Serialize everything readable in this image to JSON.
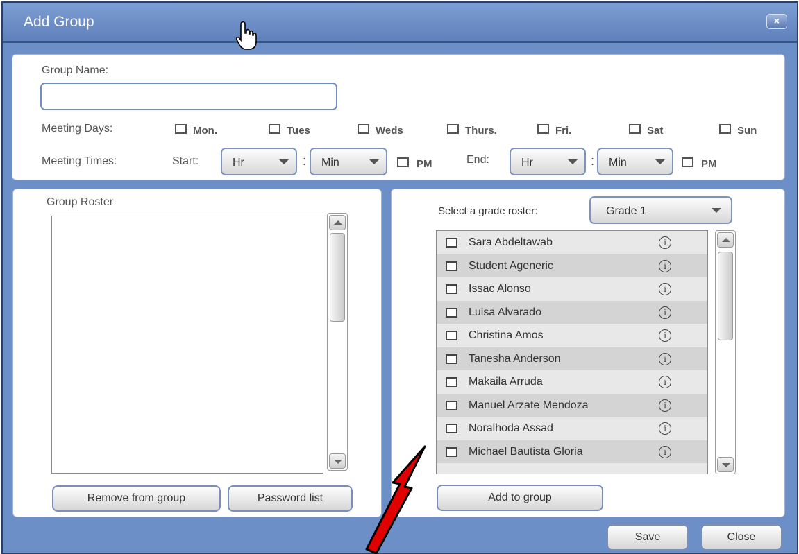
{
  "window": {
    "title": "Add Group",
    "close_label": "×"
  },
  "group": {
    "name_label": "Group Name:",
    "name_value": "",
    "days_label": "Meeting Days:",
    "days": [
      "Mon.",
      "Tues",
      "Weds",
      "Thurs.",
      "Fri.",
      "Sat",
      "Sun"
    ],
    "times_label": "Meeting Times:",
    "start_label": "Start:",
    "end_label": "End:",
    "hr": "Hr",
    "min": "Min",
    "pm": "PM",
    "colon": ":"
  },
  "roster": {
    "title": "Group Roster",
    "remove_button": "Remove from group",
    "password_button": "Password list"
  },
  "grade": {
    "select_label": "Select a grade roster:",
    "selected": "Grade 1",
    "add_button": "Add to group",
    "info_glyph": "i",
    "students": [
      "Sara Abdeltawab",
      "Student Ageneric",
      "Issac Alonso",
      "Luisa Alvarado",
      "Christina Amos",
      "Tanesha Anderson",
      "Makaila Arruda",
      "Manuel Arzate Mendoza",
      "Noralhoda Assad",
      "Michael Bautista Gloria"
    ]
  },
  "footer": {
    "save": "Save",
    "close": "Close"
  },
  "colors": {
    "window_bg": "#6d8fc8",
    "titlebar": "#5f80ba",
    "annotation_arrow": "#e00000"
  }
}
